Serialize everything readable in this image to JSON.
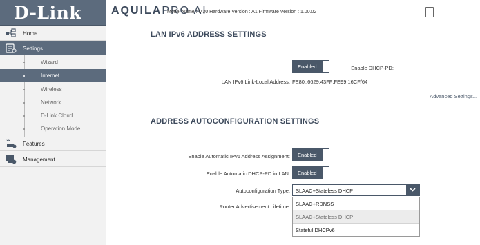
{
  "logo": {
    "text": "D-Link"
  },
  "header": {
    "brand_bold": "AQUILA",
    "brand_light": "PRO AI",
    "model_info": "Model Name : M30 Hardware Version : A1 Firmware Version : 1.00.02"
  },
  "sidebar": {
    "items": [
      {
        "label": "Home",
        "icon": "home-network-icon"
      },
      {
        "label": "Settings",
        "icon": "settings-icon"
      },
      {
        "label": "Features",
        "icon": "features-icon"
      },
      {
        "label": "Management",
        "icon": "management-icon"
      }
    ],
    "sub_items": [
      {
        "label": "Wizard"
      },
      {
        "label": "Internet"
      },
      {
        "label": "Wireless"
      },
      {
        "label": "Network"
      },
      {
        "label": "D-Link Cloud"
      },
      {
        "label": "Operation Mode"
      }
    ],
    "active_sub": "Internet"
  },
  "lan": {
    "title": "LAN IPv6 ADDRESS SETTINGS",
    "dhcp_pd_label": "Enable DHCP-PD:",
    "dhcp_pd_value": "Enabled",
    "link_local_label": "LAN IPv6 Link-Local Address:",
    "link_local_value": "FE80::6629:43FF:FE99:16CF/64",
    "advanced_link": "Advanced Settings..."
  },
  "autoconf": {
    "title": "ADDRESS AUTOCONFIGURATION SETTINGS",
    "auto_assign_label": "Enable Automatic IPv6 Address Assignment:",
    "auto_assign_value": "Enabled",
    "auto_dhcp_pd_label": "Enable Automatic DHCP-PD in LAN:",
    "auto_dhcp_pd_value": "Enabled",
    "type_label": "Autoconfiguration Type:",
    "type_selected": "SLAAC+Stateless DHCP",
    "type_options": [
      "SLAAC+RDNSS",
      "SLAAC+Stateless DHCP",
      "Stateful DHCPv6"
    ],
    "lifetime_label": "Router Advertisement Lifetime:"
  },
  "colors": {
    "accent": "#5c6b7d",
    "toggle": "#4a5869"
  }
}
